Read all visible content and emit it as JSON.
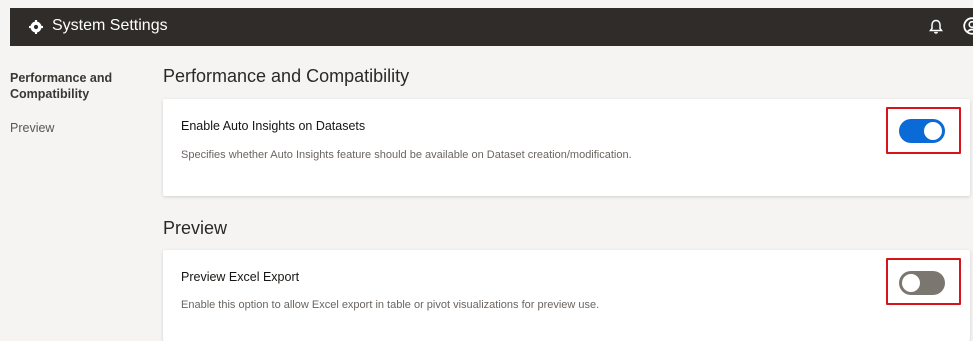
{
  "header": {
    "title": "System Settings",
    "icons": [
      "gear-icon",
      "bell-icon",
      "user-avatar-icon"
    ],
    "background": "#2f2c29"
  },
  "sidebar": {
    "items": [
      {
        "label": "Performance and Compatibility",
        "active": true
      },
      {
        "label": "Preview",
        "active": false
      }
    ]
  },
  "sections": [
    {
      "heading": "Performance and Compatibility",
      "setting": {
        "title": "Enable Auto Insights on Datasets",
        "description": "Specifies whether Auto Insights feature should be available on Dataset creation/modification.",
        "enabled": true
      }
    },
    {
      "heading": "Preview",
      "setting": {
        "title": "Preview Excel Export",
        "description": "Enable this option to allow Excel export in table or pivot visualizations for preview use.",
        "enabled": false
      }
    }
  ],
  "colors": {
    "toggle_on": "#0a6ad6",
    "toggle_off": "#7c7670",
    "highlight": "#d6141c"
  }
}
